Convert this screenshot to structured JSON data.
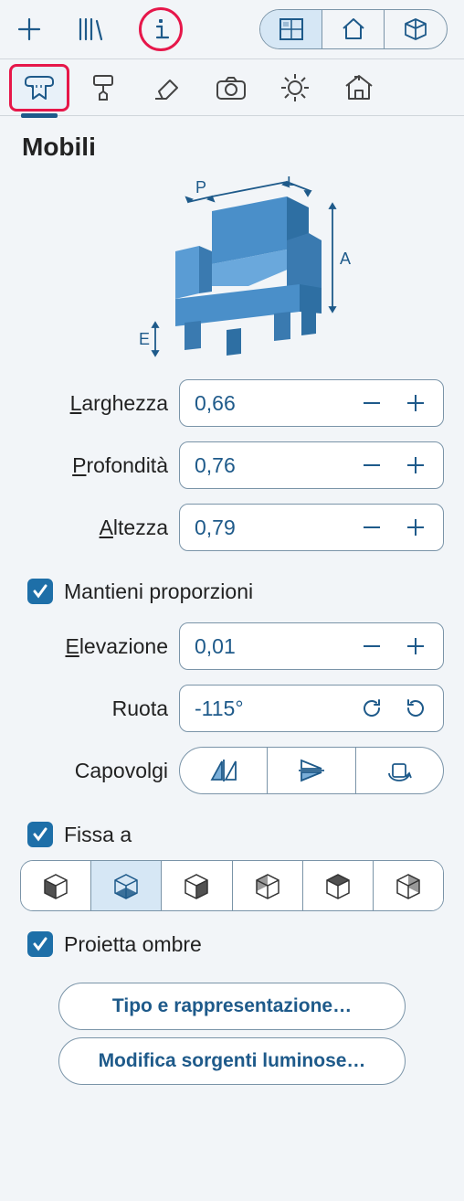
{
  "panel": {
    "title": "Mobili"
  },
  "diagram_labels": {
    "width": "L",
    "depth": "P",
    "height": "A",
    "elevation": "E"
  },
  "fields": {
    "width": {
      "label_pre": "L",
      "label_post": "arghezza",
      "value": "0,66"
    },
    "depth": {
      "label_pre": "P",
      "label_post": "rofondità",
      "value": "0,76"
    },
    "height": {
      "label_pre": "A",
      "label_post": "ltezza",
      "value": "0,79"
    },
    "elevation": {
      "label_pre": "E",
      "label_post": "levazione",
      "value": "0,01"
    },
    "rotate": {
      "label": "Ruota",
      "value": "-115°"
    },
    "flip": {
      "label": "Capovolgi"
    }
  },
  "checks": {
    "keep_proportions": "Mantieni proporzioni",
    "pin_to": "Fissa a",
    "cast_shadows": "Proietta ombre"
  },
  "buttons": {
    "type_display": "Tipo e rappresentazione…",
    "light_sources": "Modifica sorgenti luminose…"
  }
}
